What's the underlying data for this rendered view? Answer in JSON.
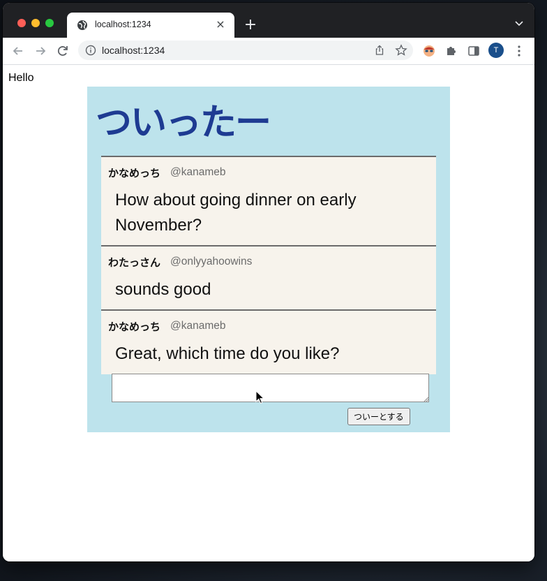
{
  "browser": {
    "tab_title": "localhost:1234",
    "tab_close": "×",
    "new_tab": "+",
    "url": "localhost:1234",
    "profile_initial": "T"
  },
  "page": {
    "hello": "Hello"
  },
  "app": {
    "title": "ついったー",
    "tweets": [
      {
        "name": "かなめっち",
        "handle": "@kanameb",
        "text": "How about going dinner on early November?"
      },
      {
        "name": "わたっさん",
        "handle": "@onlyyahoowins",
        "text": "sounds good"
      },
      {
        "name": "かなめっち",
        "handle": "@kanameb",
        "text": "Great, which time do you like?"
      }
    ],
    "compose": {
      "value": "",
      "submit_label": "ついーとする"
    }
  },
  "colors": {
    "app_background": "#bde3ec",
    "title": "#1e3b92",
    "timeline_background": "#f7f3ec"
  }
}
